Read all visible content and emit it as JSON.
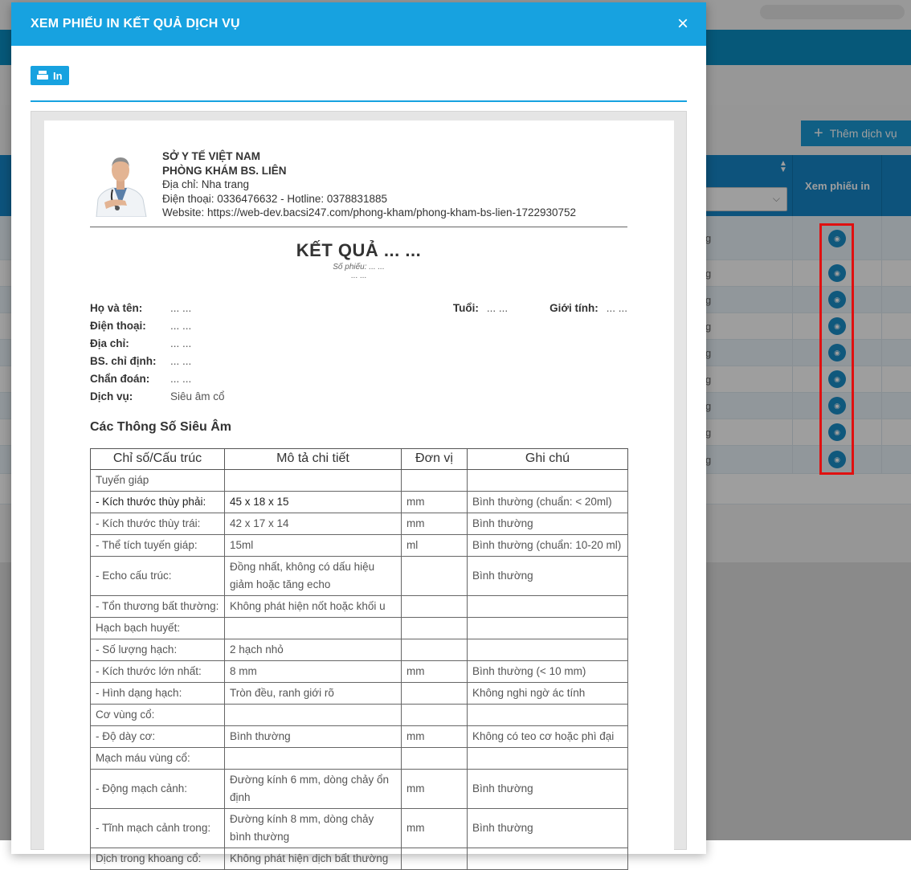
{
  "background": {
    "add_service_label": "Thêm dịch vụ",
    "print_view_col": "Xem phiếu in",
    "row_suffix": "g"
  },
  "modal": {
    "title": "XEM PHIẾU IN KẾT QUẢ DỊCH VỤ",
    "close": "×",
    "print_label": "In"
  },
  "clinic": {
    "line1": "SỞ Y TẾ VIỆT NAM",
    "line2": "PHÒNG KHÁM BS. LIÊN",
    "address": "Địa chỉ: Nha trang",
    "phone": "Điện thoại: 0336476632 - Hotline: 0378831885",
    "website": "Website: https://web-dev.bacsi247.com/phong-kham/phong-kham-bs-lien-1722930752"
  },
  "doc": {
    "title": "KẾT QUẢ ... ...",
    "number": "Số phiếu: ... ...",
    "sub": "... ..."
  },
  "patient": {
    "name_label": "Họ và tên:",
    "name": "... ...",
    "age_label": "Tuổi:",
    "age": "... ...",
    "gender_label": "Giới tính:",
    "gender": "... ...",
    "phone_label": "Điện thoại:",
    "phone": "... ...",
    "address_label": "Địa chỉ:",
    "address": "... ...",
    "doctor_label": "BS. chỉ định:",
    "doctor": "... ...",
    "diag_label": "Chẩn đoán:",
    "diag": "... ...",
    "service_label": "Dịch vụ:",
    "service": "Siêu âm cổ"
  },
  "section_title": "Các Thông Số Siêu Âm",
  "table": {
    "headers": [
      "Chỉ số/Cấu trúc",
      "Mô tả chi tiết",
      "Đơn vị",
      "Ghi chú"
    ],
    "rows": [
      [
        "Tuyến giáp",
        "",
        "",
        ""
      ],
      [
        "- Kích thước thùy phải:",
        "45 x 18 x 15",
        "mm",
        "Bình thường (chuẩn: < 20ml)"
      ],
      [
        "- Kích thước thùy trái:",
        "42 x 17 x 14",
        "mm",
        "Bình thường"
      ],
      [
        "- Thể tích tuyến giáp:",
        "15ml",
        "ml",
        "Bình thường (chuẩn: 10-20 ml)"
      ],
      [
        "- Echo cấu trúc:",
        "Đồng nhất, không có dấu hiệu giảm hoặc tăng echo",
        "",
        "Bình thường"
      ],
      [
        "- Tổn thương bất thường:",
        "Không phát hiện nốt hoặc khối u",
        "",
        ""
      ],
      [
        "Hạch bạch huyết:",
        "",
        "",
        ""
      ],
      [
        "- Số lượng hạch:",
        "2 hạch nhỏ",
        "",
        ""
      ],
      [
        "- Kích thước lớn nhất:",
        "8 mm",
        "mm",
        "Bình thường (< 10 mm)"
      ],
      [
        "- Hình dạng hạch:",
        "Tròn đều, ranh giới rõ",
        "",
        "Không nghi ngờ ác tính"
      ],
      [
        "Cơ vùng cổ:",
        "",
        "",
        ""
      ],
      [
        "- Độ dày cơ:",
        "Bình thường",
        "mm",
        "Không có teo cơ hoặc phì đại"
      ],
      [
        "Mạch máu vùng cổ:",
        "",
        "",
        ""
      ],
      [
        "- Động mạch cảnh:",
        "Đường kính 6 mm, dòng chảy ổn định",
        "mm",
        "Bình thường"
      ],
      [
        "- Tĩnh mạch cảnh trong:",
        "Đường kính 8 mm, dòng chảy bình thường",
        "mm",
        "Bình thường"
      ],
      [
        "Dịch trong khoang cổ:",
        "Không phát hiện dịch bất thường",
        "",
        ""
      ]
    ]
  },
  "colors": {
    "accent": "#17a2e0",
    "highlight": "#e01010"
  }
}
